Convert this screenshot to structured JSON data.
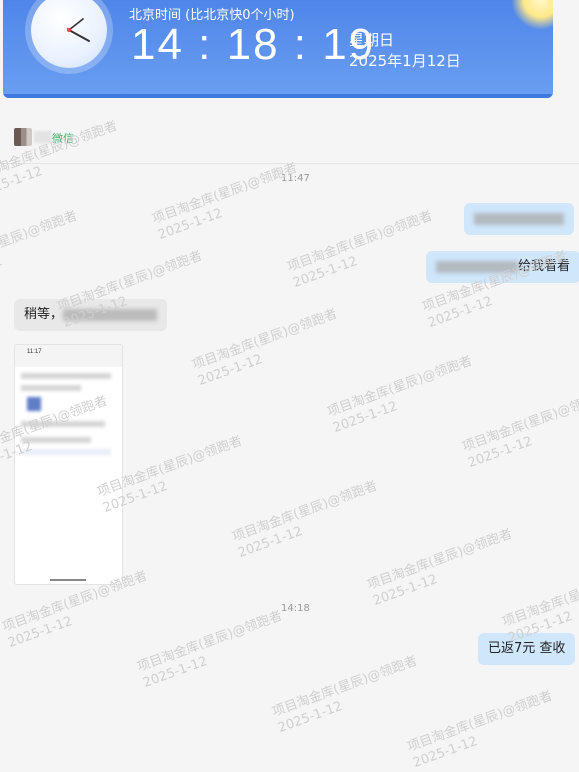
{
  "clock_widget": {
    "timezone_label": "北京时间 (比北京快0个小时)",
    "time": "14 : 18 : 19",
    "weekday": "星期日",
    "date": "2025年1月12日"
  },
  "chat": {
    "contact_name": "微信",
    "timestamps": [
      "11:47",
      "14:18"
    ],
    "messages": {
      "m2_suffix": "给我看看",
      "m3_prefix": "稍等，",
      "m5_text": "已返7元 查收"
    },
    "thumbnail_time": "11:17"
  },
  "watermark": {
    "line1": "项目淘金库(星辰)@领跑者",
    "line2": "2025-1-12"
  },
  "colors": {
    "header_blue": "#5a8fec",
    "my_bubble": "#cfe6fb",
    "other_bubble": "#e8e8e8",
    "contact_green": "#39b36b"
  }
}
